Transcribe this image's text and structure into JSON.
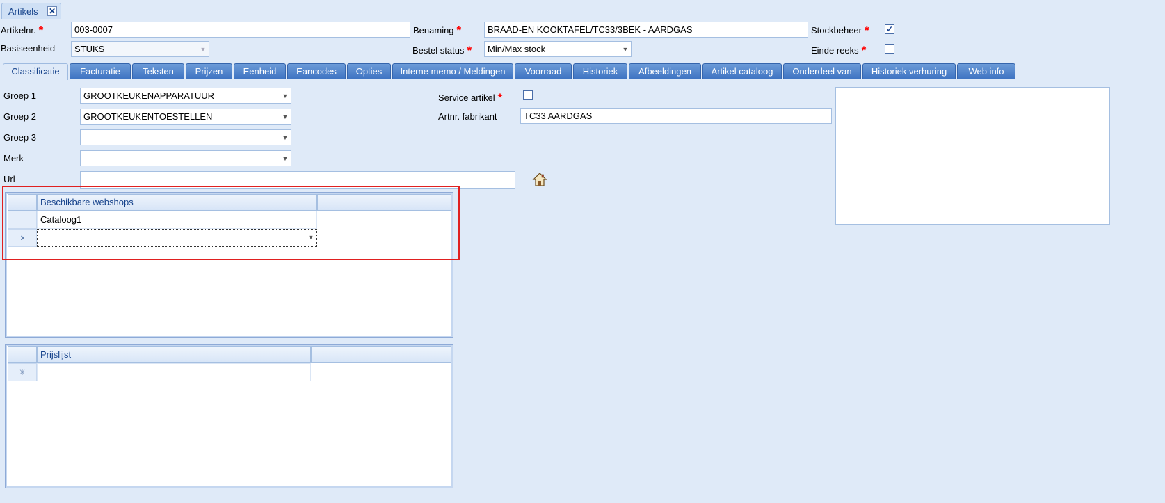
{
  "doc_tab": {
    "label": "Artikels",
    "close": "✕"
  },
  "header": {
    "artikelnr_label": "Artikelnr.",
    "artikelnr_value": "003-0007",
    "benaming_label": "Benaming",
    "benaming_value": "BRAAD-EN KOOKTAFEL/TC33/3BEK - AARDGAS",
    "stockbeheer_label": "Stockbeheer",
    "stockbeheer_checked": true,
    "basiseenheid_label": "Basiseenheid",
    "basiseenheid_value": "STUKS",
    "bestel_status_label": "Bestel status",
    "bestel_status_value": "Min/Max stock",
    "einde_reeks_label": "Einde reeks",
    "einde_reeks_checked": false,
    "required_mark": "*"
  },
  "tabs": [
    {
      "label": "Classificatie",
      "active": true
    },
    {
      "label": "Facturatie"
    },
    {
      "label": "Teksten"
    },
    {
      "label": "Prijzen"
    },
    {
      "label": "Eenheid"
    },
    {
      "label": "Eancodes"
    },
    {
      "label": "Opties"
    },
    {
      "label": "Interne memo / Meldingen"
    },
    {
      "label": "Voorraad"
    },
    {
      "label": "Historiek"
    },
    {
      "label": "Afbeeldingen"
    },
    {
      "label": "Artikel cataloog"
    },
    {
      "label": "Onderdeel van"
    },
    {
      "label": "Historiek verhuring"
    },
    {
      "label": "Web info"
    }
  ],
  "classificatie": {
    "groep1_label": "Groep 1",
    "groep1_value": "GROOTKEUKENAPPARATUUR",
    "groep2_label": "Groep 2",
    "groep2_value": "GROOTKEUKENTOESTELLEN",
    "groep3_label": "Groep 3",
    "groep3_value": "",
    "merk_label": "Merk",
    "merk_value": "",
    "url_label": "Url",
    "url_value": "",
    "service_artikel_label": "Service artikel",
    "service_artikel_checked": false,
    "artnr_fabrikant_label": "Artnr. fabrikant",
    "artnr_fabrikant_value": "TC33 AARDGAS"
  },
  "webshops_grid": {
    "header": "Beschikbare webshops",
    "rows": [
      "Cataloog1"
    ],
    "current_row_indicator": "›",
    "new_row_value": ""
  },
  "prijslijst_grid": {
    "header": "Prijslijst",
    "new_row_indicator": "✳",
    "new_row_value": ""
  },
  "icons": {
    "url_button": "home-icon",
    "dropdown": "chevron-down-icon"
  },
  "colors": {
    "required": "#ff0000",
    "tab_active_text": "#15428b",
    "tab_bg": "#3f74c3",
    "highlight": "#e02020"
  }
}
